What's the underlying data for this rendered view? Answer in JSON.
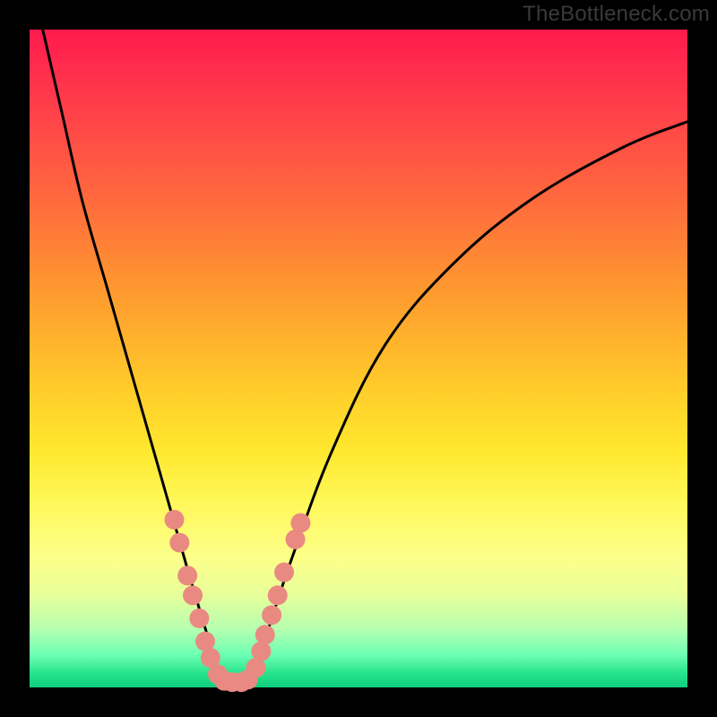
{
  "watermark": {
    "text": "TheBottleneck.com"
  },
  "chart_data": {
    "type": "line",
    "title": "",
    "xlabel": "",
    "ylabel": "",
    "xlim": [
      0,
      100
    ],
    "ylim": [
      0,
      100
    ],
    "series": [
      {
        "name": "bottleneck-curve",
        "x": [
          2,
          5,
          8,
          12,
          16,
          20,
          24,
          27,
          28.5,
          30,
          32,
          34,
          36,
          40,
          46,
          54,
          64,
          76,
          90,
          100
        ],
        "y": [
          100,
          87,
          74,
          60,
          46,
          32,
          18,
          8,
          3,
          0.5,
          0.5,
          2,
          8,
          20,
          36,
          52,
          64,
          74,
          82,
          86
        ]
      }
    ],
    "markers": {
      "name": "highlight-dots",
      "color": "#e98a82",
      "radius_px": 11,
      "points": [
        {
          "x": 22.0,
          "y": 25.5
        },
        {
          "x": 22.8,
          "y": 22.0
        },
        {
          "x": 24.0,
          "y": 17.0
        },
        {
          "x": 24.8,
          "y": 14.0
        },
        {
          "x": 25.8,
          "y": 10.5
        },
        {
          "x": 26.7,
          "y": 7.0
        },
        {
          "x": 27.5,
          "y": 4.5
        },
        {
          "x": 28.6,
          "y": 2.0
        },
        {
          "x": 29.6,
          "y": 1.0
        },
        {
          "x": 30.8,
          "y": 0.8
        },
        {
          "x": 32.2,
          "y": 0.8
        },
        {
          "x": 33.2,
          "y": 1.2
        },
        {
          "x": 34.4,
          "y": 3.0
        },
        {
          "x": 35.2,
          "y": 5.5
        },
        {
          "x": 35.8,
          "y": 8.0
        },
        {
          "x": 36.8,
          "y": 11.0
        },
        {
          "x": 37.7,
          "y": 14.0
        },
        {
          "x": 38.7,
          "y": 17.5
        },
        {
          "x": 40.4,
          "y": 22.5
        },
        {
          "x": 41.2,
          "y": 25.0
        }
      ]
    },
    "colors": {
      "gradient_top": "#ff1a4d",
      "gradient_bottom": "#0fce7e",
      "curve": "#000000",
      "markers": "#e98a82",
      "frame": "#000000"
    }
  }
}
